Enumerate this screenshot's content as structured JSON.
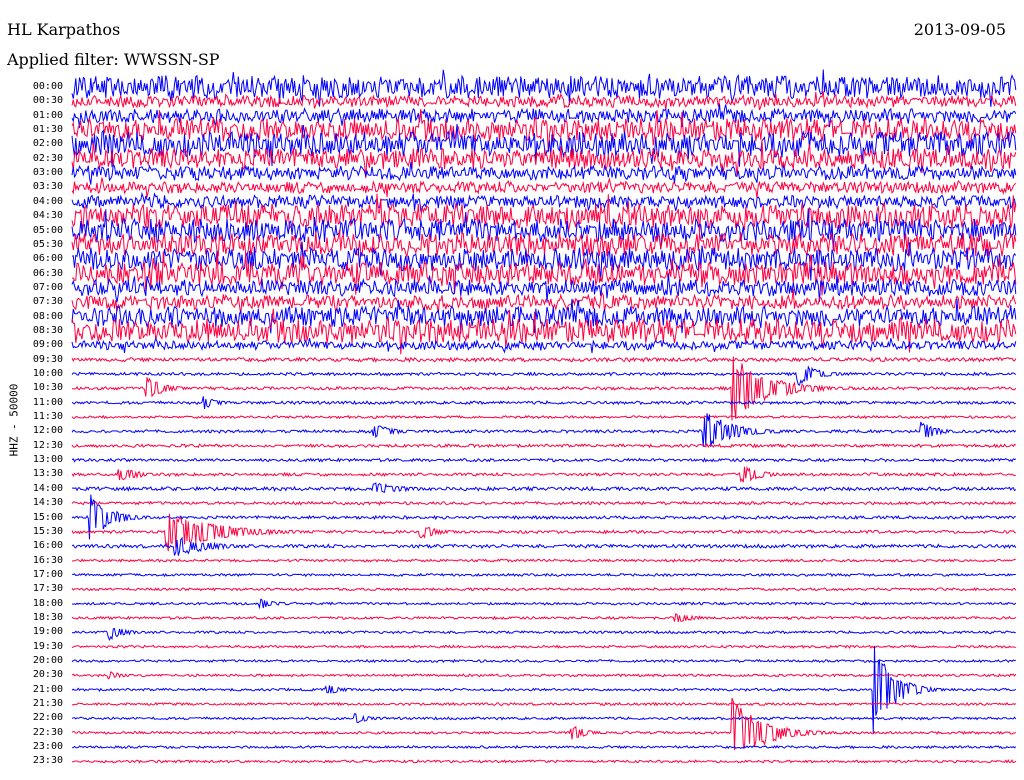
{
  "header": {
    "station": "HL Karpathos",
    "date": "2013-09-05",
    "filter": "Applied filter: WWSSN-SP"
  },
  "channel_label": "HHZ - 50000",
  "colors": {
    "even_hours": "#0000ff",
    "odd_hours": "#ff0040",
    "background": "#ffffff"
  },
  "chart_data": {
    "type": "line",
    "title": "HL Karpathos",
    "subtitle": "Applied filter: WWSSN-SP",
    "date": "2013-09-05",
    "ylabel": "HHZ - 50000",
    "row_minutes": 30,
    "series_colors": [
      "#0000ff",
      "#ff0040"
    ],
    "time_labels": [
      "00:00",
      "00:30",
      "01:00",
      "01:30",
      "02:00",
      "02:30",
      "03:00",
      "03:30",
      "04:00",
      "04:30",
      "05:00",
      "05:30",
      "06:00",
      "06:30",
      "07:00",
      "07:30",
      "08:00",
      "08:30",
      "09:00",
      "09:30",
      "10:00",
      "10:30",
      "11:00",
      "11:30",
      "12:00",
      "12:30",
      "13:00",
      "13:30",
      "14:00",
      "14:30",
      "15:00",
      "15:30",
      "16:00",
      "16:30",
      "17:00",
      "17:30",
      "18:00",
      "18:30",
      "19:00",
      "19:30",
      "20:00",
      "20:30",
      "21:00",
      "21:30",
      "22:00",
      "22:30",
      "23:00",
      "23:30"
    ],
    "noise_levels": [
      0.9,
      0.45,
      0.55,
      0.9,
      1.0,
      0.8,
      0.55,
      0.45,
      0.5,
      0.95,
      0.9,
      0.9,
      0.9,
      0.9,
      0.65,
      0.55,
      0.8,
      0.95,
      0.35,
      0.15,
      0.12,
      0.12,
      0.12,
      0.1,
      0.12,
      0.12,
      0.12,
      0.12,
      0.14,
      0.12,
      0.12,
      0.12,
      0.14,
      0.1,
      0.1,
      0.1,
      0.1,
      0.1,
      0.1,
      0.1,
      0.1,
      0.1,
      0.1,
      0.1,
      0.1,
      0.1,
      0.1,
      0.1
    ],
    "events": [
      {
        "row": 21,
        "pos": 0.08,
        "amp": 0.9,
        "len": 0.018
      },
      {
        "row": 21,
        "pos": 0.7,
        "amp": 2.6,
        "len": 0.035
      },
      {
        "row": 20,
        "pos": 0.77,
        "amp": 0.9,
        "len": 0.02
      },
      {
        "row": 22,
        "pos": 0.14,
        "amp": 0.5,
        "len": 0.015
      },
      {
        "row": 24,
        "pos": 0.67,
        "amp": 1.6,
        "len": 0.03
      },
      {
        "row": 24,
        "pos": 0.9,
        "amp": 0.8,
        "len": 0.015
      },
      {
        "row": 24,
        "pos": 0.32,
        "amp": 0.6,
        "len": 0.02
      },
      {
        "row": 27,
        "pos": 0.71,
        "amp": 0.7,
        "len": 0.02
      },
      {
        "row": 27,
        "pos": 0.05,
        "amp": 0.6,
        "len": 0.02
      },
      {
        "row": 28,
        "pos": 0.32,
        "amp": 0.5,
        "len": 0.03
      },
      {
        "row": 30,
        "pos": 0.02,
        "amp": 1.8,
        "len": 0.02
      },
      {
        "row": 31,
        "pos": 0.1,
        "amp": 1.6,
        "len": 0.05
      },
      {
        "row": 31,
        "pos": 0.37,
        "amp": 0.5,
        "len": 0.02
      },
      {
        "row": 32,
        "pos": 0.11,
        "amp": 0.9,
        "len": 0.03
      },
      {
        "row": 36,
        "pos": 0.2,
        "amp": 0.4,
        "len": 0.015
      },
      {
        "row": 37,
        "pos": 0.64,
        "amp": 0.4,
        "len": 0.02
      },
      {
        "row": 38,
        "pos": 0.04,
        "amp": 0.6,
        "len": 0.015
      },
      {
        "row": 41,
        "pos": 0.04,
        "amp": 0.3,
        "len": 0.015
      },
      {
        "row": 42,
        "pos": 0.85,
        "amp": 3.4,
        "len": 0.02
      },
      {
        "row": 42,
        "pos": 0.27,
        "amp": 0.4,
        "len": 0.015
      },
      {
        "row": 44,
        "pos": 0.3,
        "amp": 0.4,
        "len": 0.015
      },
      {
        "row": 45,
        "pos": 0.7,
        "amp": 2.8,
        "len": 0.03
      },
      {
        "row": 45,
        "pos": 0.53,
        "amp": 0.6,
        "len": 0.015
      }
    ]
  }
}
